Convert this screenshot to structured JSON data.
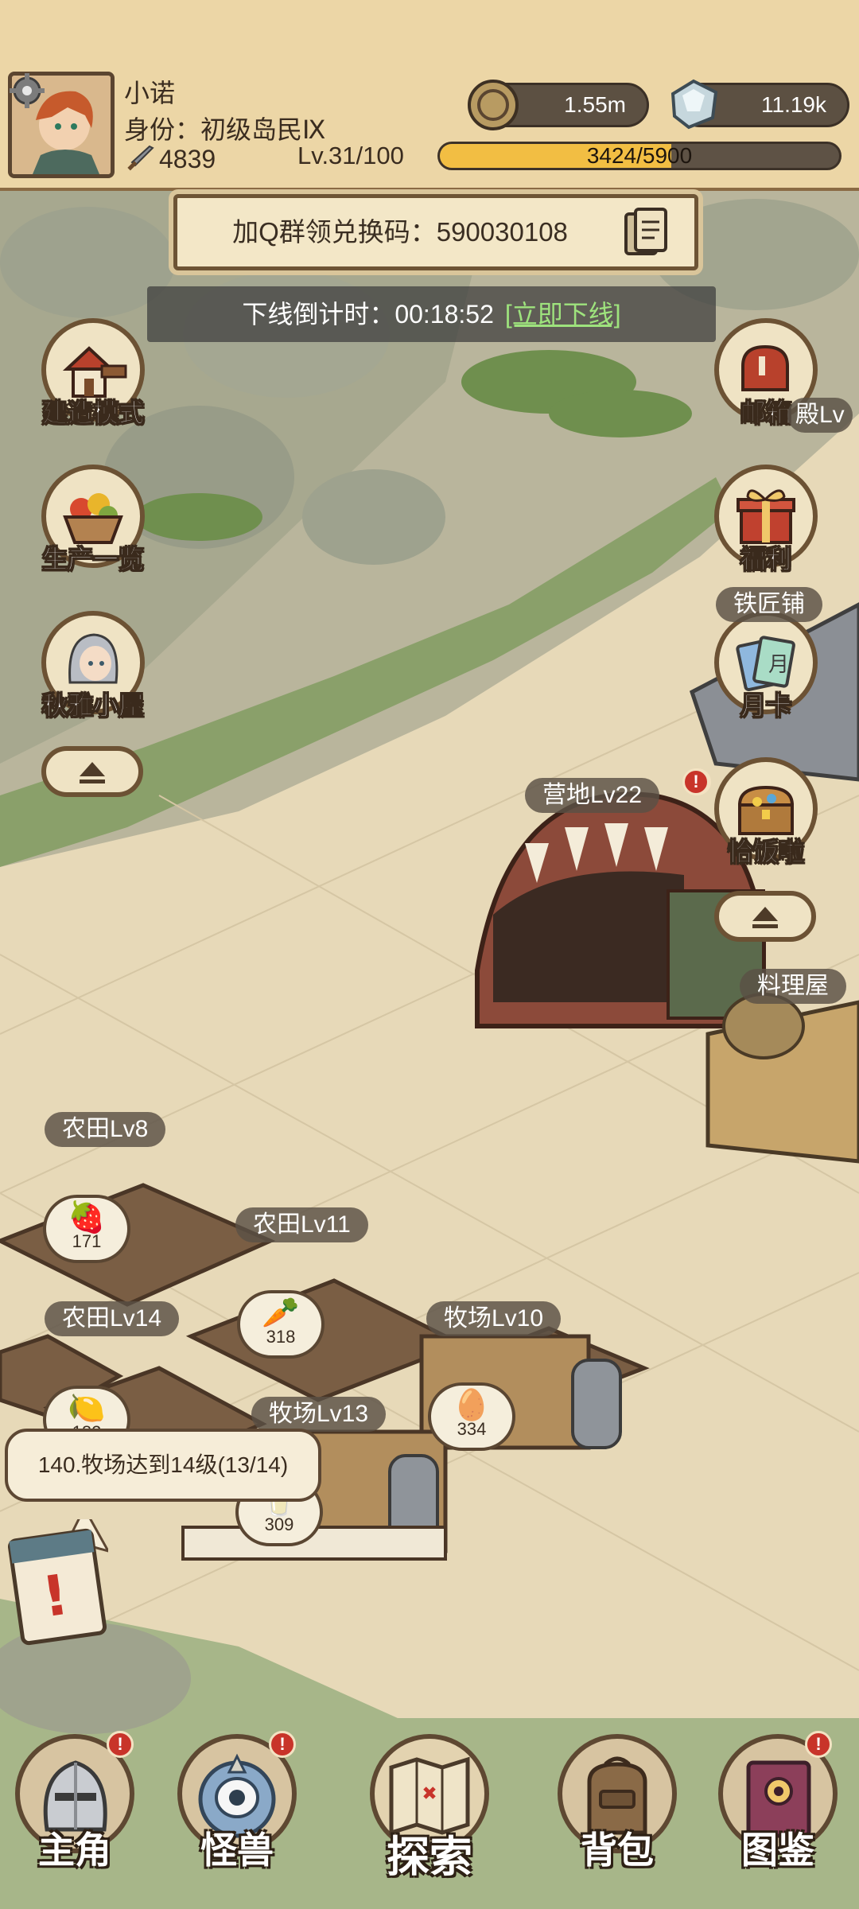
{
  "player": {
    "name": "小诺",
    "identity": "身份：初级岛民Ⅸ",
    "power": "4839",
    "level": "Lv.31/100",
    "xp_text": "3424/5900",
    "xp_fraction": 0.58
  },
  "currencies": {
    "coins": "1.55m",
    "gems": "11.19k"
  },
  "banner": {
    "code_text": "加Q群领兑换码：590030108",
    "timer_label": "下线倒计时：00:18:52",
    "offline_link": "[立即下线]"
  },
  "left_menu": [
    {
      "label": "建造模式",
      "icon": "hammer-house-icon"
    },
    {
      "label": "生产一览",
      "icon": "fruit-basket-icon"
    },
    {
      "label": "秋雅小屋",
      "icon": "character-portrait-icon"
    }
  ],
  "right_menu": [
    {
      "label": "邮箱",
      "icon": "mailbox-icon"
    },
    {
      "label": "福利",
      "icon": "gift-box-icon"
    },
    {
      "label": "月卡",
      "icon": "month-card-icon"
    },
    {
      "label": "恰饭啦",
      "icon": "treasure-chest-icon"
    }
  ],
  "map_labels": {
    "partial_top": "殿Lv",
    "blacksmith": "铁匠铺",
    "camp": "营地Lv22",
    "kitchen": "料理屋",
    "farm8": "农田Lv8",
    "farm11": "农田Lv11",
    "farm14": "农田Lv14",
    "ranch10": "牧场Lv10",
    "ranch13": "牧场Lv13"
  },
  "resource_bubbles": [
    {
      "icon": "strawberry-icon",
      "count": "171"
    },
    {
      "icon": "carrot-icon",
      "count": "318"
    },
    {
      "icon": "egg-icon",
      "count": "334"
    },
    {
      "icon": "lemon-icon",
      "count": "182"
    },
    {
      "icon": "milk-icon",
      "count": "309"
    }
  ],
  "task": {
    "text": "140.牧场达到14级(13/14)"
  },
  "bottom_nav": [
    {
      "label": "主角",
      "icon": "knight-helmet-icon",
      "badge": "!"
    },
    {
      "label": "怪兽",
      "icon": "monster-eye-icon",
      "badge": "!"
    },
    {
      "label": "探索",
      "icon": "treasure-map-icon",
      "badge": ""
    },
    {
      "label": "背包",
      "icon": "backpack-icon",
      "badge": ""
    },
    {
      "label": "图鉴",
      "icon": "codex-book-icon",
      "badge": "!"
    }
  ]
}
